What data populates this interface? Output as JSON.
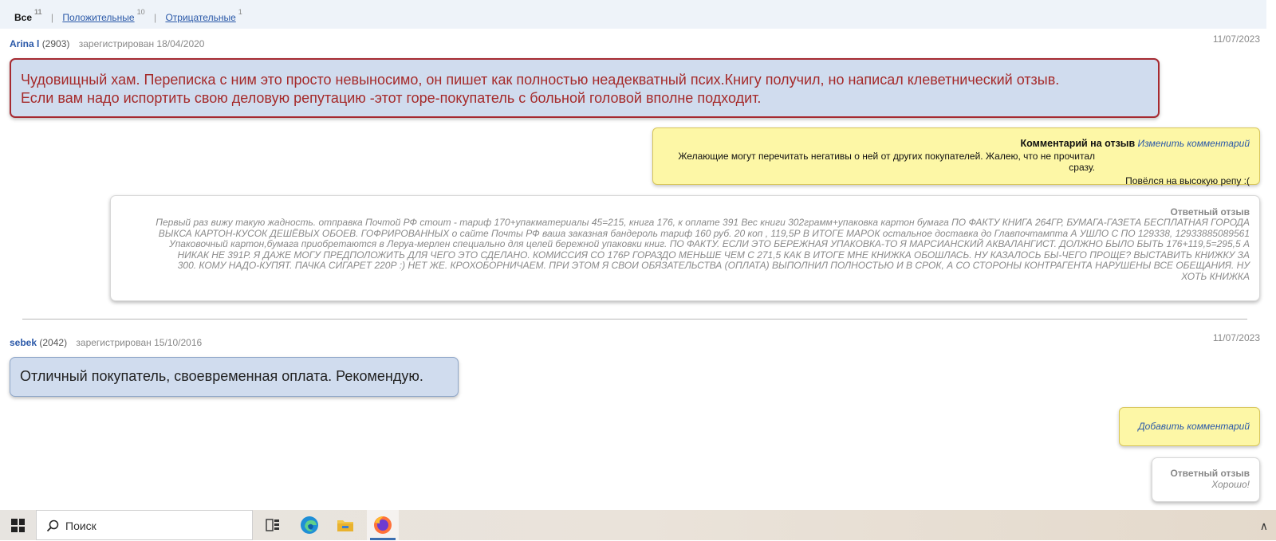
{
  "filter": {
    "all_label": "Все",
    "all_count": "11",
    "positive_label": "Положительные",
    "positive_count": "10",
    "negative_label": "Отрицательные",
    "negative_count": "1",
    "separator": "|"
  },
  "reviews": [
    {
      "username": "Arina l",
      "rating": "(2903)",
      "registered": "зарегистрирован 18/04/2020",
      "date": "11/07/2023",
      "type": "negative",
      "text_lines": [
        "Чудовищный хам. Переписка с ним это просто невыносимо, он пишет как полностью неадекватный псих.Книгу получил, но написал клеветнический отзыв.",
        "Если вам надо испортить свою деловую репутацию -этот горе-покупатель с больной головой вполне подходит."
      ],
      "comment": {
        "title": "Комментарий на отзыв",
        "edit_label": "Изменить комментарий",
        "line1": "Желающие могут перечитать негативы о ней от других покупателей. Жалею, что не прочитал сразу.",
        "line2": "Повёлся на высокую репу :("
      },
      "answer": {
        "title": "Ответный отзыв",
        "lines": [
          "Первый раз вижу такую жадность. отправка Почтой РФ стоит - тариф 170+упакматериалы 45=215, книга 176, к оплате 391 Вес книги 302грамм+упаковка картон бумага ПО ФАКТУ КНИГА 264ГР, БУМАГА-ГАЗЕТА БЕСПЛАТНАЯ ГОРОДА",
          "ВЫКСА КАРТОН-КУСОК ДЕШЁВЫХ ОБОЕВ. ГОФРИРОВАННЫХ о сайте Почты РФ ваша заказная бандероль тариф 160 руб. 20 коп , 119,5Р В ИТОГЕ МАРОК остальное доставка до Главпочтампта А УШЛО С ПО 129338, 12933885089561",
          "Упаковочный картон,бумага приобретаются в Леруа-мерлен специально для целей бережной упаковки книг. ПО ФАКТУ. ЕСЛИ ЭТО БЕРЕЖНАЯ УПАКОВКА-ТО Я МАРСИАНСКИЙ АКВАЛАНГИСТ. ДОЛЖНО БЫЛО БЫТЬ 176+119,5=295,5 А",
          "НИКАК НЕ 391Р. Я ДАЖЕ МОГУ ПРЕДПОЛОЖИТЬ ДЛЯ ЧЕГО ЭТО СДЕЛАНО. КОМИССИЯ СО 176Р ГОРАЗДО МЕНЬШЕ ЧЕМ С 271,5 КАК В ИТОГЕ МНЕ КНИЖКА ОБОШЛАСЬ. НУ КАЗАЛОСЬ БЫ-ЧЕГО ПРОЩЕ? ВЫСТАВИТЬ КНИЖКУ ЗА",
          "300. КОМУ НАДО-КУПЯТ. ПАЧКА СИГАРЕТ 220Р :) НЕТ ЖЕ. КРОХОБОРНИЧАЕМ. ПРИ ЭТОМ Я СВОИ ОБЯЗАТЕЛЬСТВА (ОПЛАТА) ВЫПОЛНИЛ ПОЛНОСТЬЮ И В СРОК, А СО СТОРОНЫ КОНТРАГЕНТА НАРУШЕНЫ ВСЕ ОБЕЩАНИЯ. НУ",
          "ХОТЬ КНИЖКА"
        ]
      }
    },
    {
      "username": "sebek",
      "rating": "(2042)",
      "registered": "зарегистрирован 15/10/2016",
      "date": "11/07/2023",
      "type": "positive",
      "text": "Отличный покупатель, своевременная оплата. Рекомендую.",
      "comment": {
        "add_label": "Добавить комментарий"
      },
      "answer": {
        "title": "Ответный отзыв",
        "text": "Хорошо!"
      }
    }
  ],
  "taskbar": {
    "search_placeholder": "Поиск",
    "colors": {
      "edge": "#1f8fd6",
      "explorer": "#f2c64a",
      "firefox": "#ff7139"
    }
  }
}
